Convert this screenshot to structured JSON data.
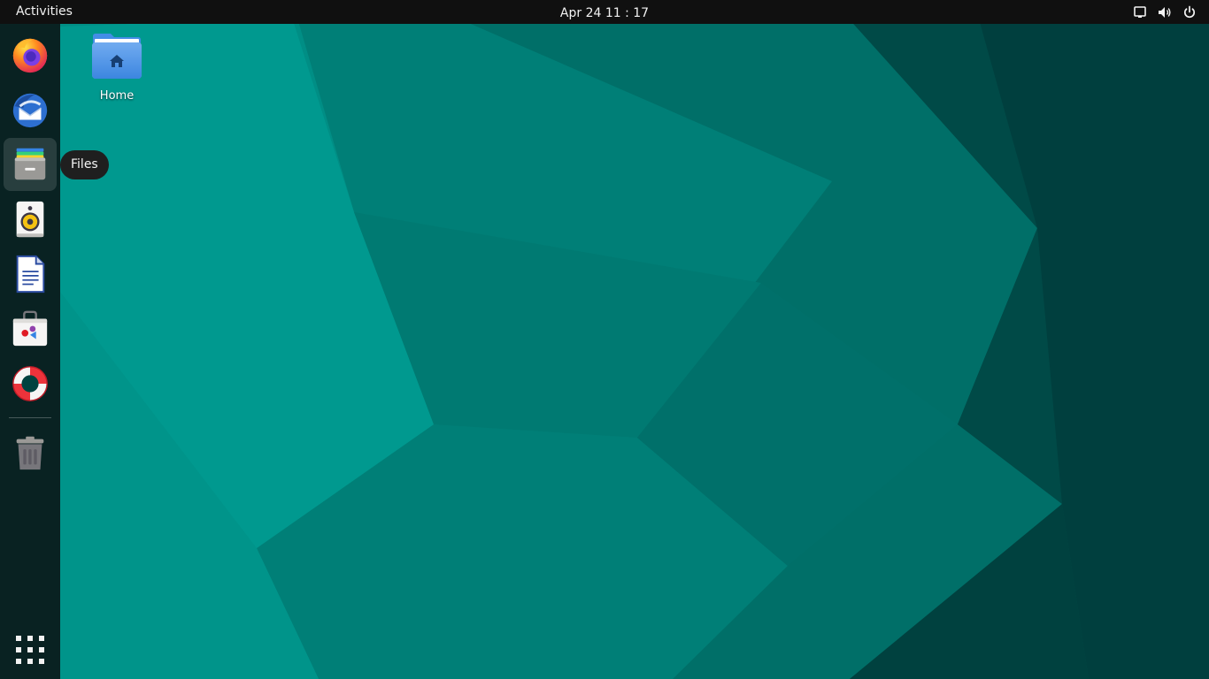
{
  "topbar": {
    "activities_label": "Activities",
    "clock": "Apr 24  11 : 17",
    "tray_icons": [
      "screen-icon",
      "volume-icon",
      "power-icon"
    ]
  },
  "dock": {
    "apps": [
      {
        "name": "Firefox",
        "icon": "firefox-icon"
      },
      {
        "name": "Thunderbird",
        "icon": "thunderbird-icon"
      },
      {
        "name": "Files",
        "icon": "files-icon",
        "active": true
      },
      {
        "name": "Rhythmbox",
        "icon": "rhythmbox-icon"
      },
      {
        "name": "LibreOffice Writer",
        "icon": "writer-icon"
      },
      {
        "name": "Ubuntu Software",
        "icon": "software-icon"
      },
      {
        "name": "Help",
        "icon": "help-icon"
      },
      {
        "name": "Trash",
        "icon": "trash-icon"
      }
    ],
    "show_apps_icon": "app-grid-icon",
    "tooltip": "Files"
  },
  "desktop": {
    "icons": [
      {
        "label": "Home",
        "icon": "home-folder-icon"
      }
    ]
  },
  "colors": {
    "topbar_bg": "#101010",
    "dock_bg": "#0a1a1b",
    "wallpaper_primary": "#00897d",
    "wallpaper_dark": "#00413f"
  }
}
